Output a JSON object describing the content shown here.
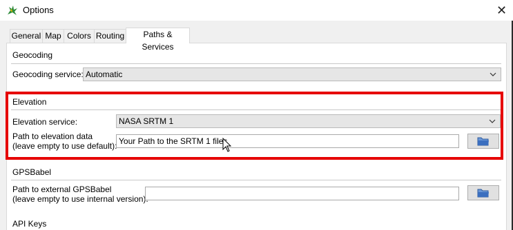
{
  "window": {
    "title": "Options",
    "close_glyph": "✕"
  },
  "tabs": [
    {
      "label": "General"
    },
    {
      "label": "Map"
    },
    {
      "label": "Colors"
    },
    {
      "label": "Routing"
    },
    {
      "label": "Paths & Services",
      "active": true
    }
  ],
  "geocoding": {
    "title": "Geocoding",
    "service_label": "Geocoding service:",
    "service_value": "Automatic"
  },
  "elevation": {
    "title": "Elevation",
    "service_label": "Elevation service:",
    "service_value": "NASA SRTM 1",
    "path_label_line1": "Path to elevation data",
    "path_label_line2": "(leave empty to use default):",
    "path_value": "Your Path to the SRTM 1 files"
  },
  "gpsbabel": {
    "title": "GPSBabel",
    "path_label_line1": "Path to external GPSBabel",
    "path_label_line2": "(leave empty to use internal version):",
    "path_value": ""
  },
  "api_keys": {
    "title": "API Keys"
  },
  "colors": {
    "highlight": "#e60000",
    "folder": "#3b6fbf"
  },
  "icons": {
    "app": "app-logo-icon",
    "close": "close-icon",
    "chevron": "chevron-down-icon",
    "folder": "folder-icon",
    "cursor": "mouse-pointer-icon"
  }
}
